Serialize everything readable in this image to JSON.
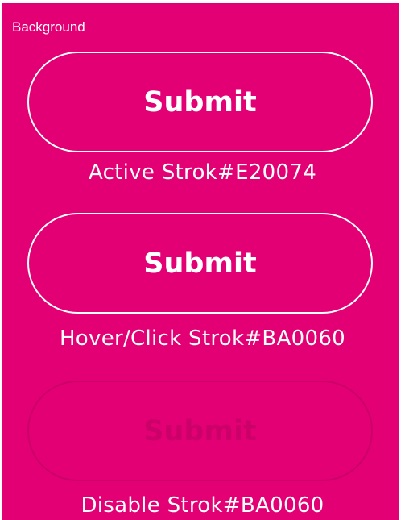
{
  "panel": {
    "label": "Background",
    "background_color": "#E20074"
  },
  "buttons": [
    {
      "label": "Submit",
      "state": "active",
      "caption": "Active Strok#E20074",
      "stroke_color": "#FFFFFF"
    },
    {
      "label": "Submit",
      "state": "hover",
      "caption": "Hover/Click Strok#BA0060",
      "stroke_color": "#FFFFFF"
    },
    {
      "label": "Submit",
      "state": "disabled",
      "caption": "Disable Strok#BA0060",
      "stroke_color": "#BA0060"
    }
  ]
}
